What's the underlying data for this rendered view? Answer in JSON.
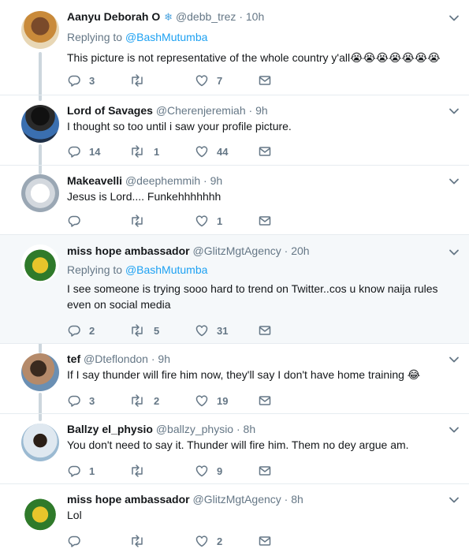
{
  "tweets": [
    {
      "name": "Aanyu Deborah O",
      "name_suffix": "❄",
      "handle": "@debb_trez",
      "time": "10h",
      "replying_prefix": "Replying to",
      "replying_to": "@BashMutumba",
      "text": "This picture is not representative of the whole country y'all😭😭😭😭😭😭😭",
      "replies": "3",
      "retweets": "",
      "likes": "7"
    },
    {
      "name": "Lord of Savages",
      "handle": "@Cherenjeremiah",
      "time": "9h",
      "text": "I thought so too until i saw your profile picture.",
      "replies": "14",
      "retweets": "1",
      "likes": "44"
    },
    {
      "name": "Makeavelli",
      "handle": "@deephemmih",
      "time": "9h",
      "text": "Jesus is Lord.... Funkehhhhhhh",
      "replies": "",
      "retweets": "",
      "likes": "1"
    },
    {
      "name": "miss hope ambassador",
      "handle": "@GlitzMgtAgency",
      "time": "20h",
      "replying_prefix": "Replying to",
      "replying_to": "@BashMutumba",
      "text_line1": "I see someone is trying sooo hard to trend on Twitter..cos u know naija rules",
      "text_line2": "even on social media",
      "replies": "2",
      "retweets": "5",
      "likes": "31"
    },
    {
      "name": "tef",
      "handle": "@Dteflondon",
      "time": "9h",
      "text": "If I say thunder will fire him now, they'll say I don't have home training 😂",
      "replies": "3",
      "retweets": "2",
      "likes": "19"
    },
    {
      "name": "Ballzy el_physio",
      "handle": "@ballzy_physio",
      "time": "8h",
      "text": "You don't need to say it. Thunder will fire him. Them no dey argue am.",
      "replies": "1",
      "retweets": "",
      "likes": "9"
    },
    {
      "name": "miss hope ambassador",
      "handle": "@GlitzMgtAgency",
      "time": "8h",
      "text": "Lol",
      "replies": "",
      "retweets": "",
      "likes": "2"
    }
  ],
  "separator": "·",
  "colors": {
    "accent": "#1da1f2",
    "muted": "#657786",
    "highlight_bg": "#f5f8fa",
    "thread_line": "#ccd6dd"
  },
  "icons": {
    "reply": "reply-icon",
    "retweet": "retweet-icon",
    "like": "heart-icon",
    "dm": "envelope-icon",
    "menu": "chevron-down-icon"
  }
}
